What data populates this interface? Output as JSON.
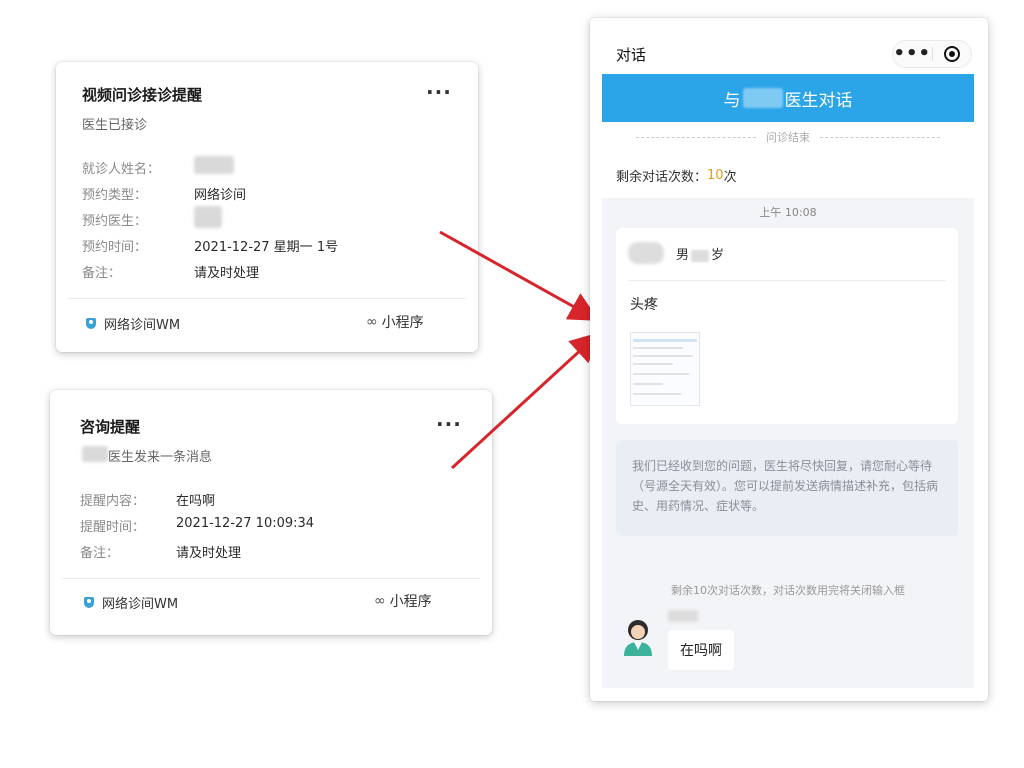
{
  "card1": {
    "title": "视频问诊接诊提醒",
    "subtitle": "医生已接诊",
    "fields": [
      {
        "label": "就诊人姓名：",
        "value": ""
      },
      {
        "label": "预约类型：",
        "value": "网络诊间"
      },
      {
        "label": "预约医生：",
        "value": ""
      },
      {
        "label": "预约时间：",
        "value": "2021-12-27 星期一 1号"
      },
      {
        "label": "备注：",
        "value": "请及时处理"
      }
    ],
    "footer_left": "网络诊间WM",
    "footer_right": "小程序"
  },
  "card2": {
    "title": "咨询提醒",
    "subtitle": "医生发来一条消息",
    "fields": [
      {
        "label": "提醒内容：",
        "value": "在吗啊"
      },
      {
        "label": "提醒时间：",
        "value": "2021-12-27 10:09:34"
      },
      {
        "label": "备注：",
        "value": "请及时处理"
      }
    ],
    "footer_left": "网络诊间WM",
    "footer_right": "小程序"
  },
  "chat": {
    "title": "对话",
    "banner_prefix": "与",
    "banner_suffix": "医生对话",
    "status": "问诊结束",
    "remain_label": "剩余对话次数：",
    "remain_count": "10",
    "remain_unit": "次",
    "time": "上午 10:08",
    "patient_gender": "男",
    "patient_age_unit": "岁",
    "symptom": "头疼",
    "notice": "我们已经收到您的问题，医生将尽快回复，请您耐心等待（号源全天有效）。您可以提前发送病情描述补充，包括病史、用药情况、症状等。",
    "remain_tip": "剩余10次对话次数，对话次数用完将关闭输入框",
    "doctor_message": "在吗啊"
  },
  "icons": {
    "more": "more-dots-icon",
    "target": "target-icon",
    "mini_program": "mini-program-icon",
    "link": "link-icon"
  },
  "colors": {
    "banner": "#2ba5e8",
    "arrow": "#d6252b",
    "remain_count": "#e0a020"
  }
}
